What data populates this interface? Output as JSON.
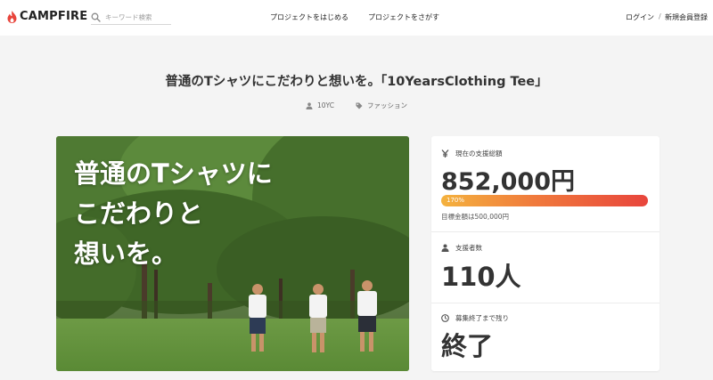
{
  "header": {
    "brand": "CAMPFIRE",
    "search_placeholder": "キーワード検索",
    "nav_start": "プロジェクトをはじめる",
    "nav_find": "プロジェクトをさがす",
    "login": "ログイン",
    "separator": "/",
    "register": "新規会員登録"
  },
  "project": {
    "title": "普通のTシャツにこだわりと想いを。「10YearsClothing Tee」",
    "owner": "10YC",
    "category": "ファッション",
    "hero_text_lines": [
      "普通のTシャツに",
      "こだわりと",
      "想いを。"
    ]
  },
  "stats": {
    "total_label": "現在の支援総額",
    "total_value": "852,000円",
    "progress_percent": 170,
    "progress_label": "170%",
    "goal_text": "目標金額は500,000円",
    "supporters_label": "支援者数",
    "supporters_value": "110人",
    "remaining_label": "募集終了まで残り",
    "remaining_value": "終了"
  },
  "colors": {
    "brand_accent": "#e8453c",
    "progress_start": "#f4b23e",
    "progress_end": "#e8453c"
  }
}
